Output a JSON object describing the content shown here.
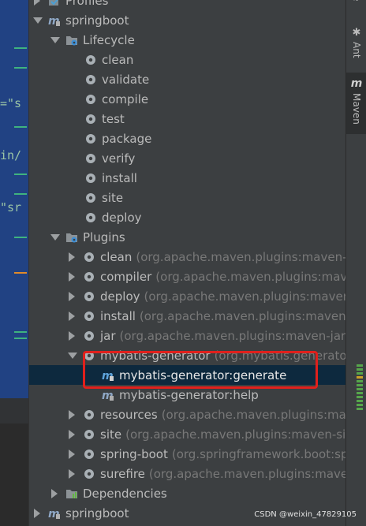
{
  "tree": {
    "top_partial": "Profiles",
    "project": "springboot",
    "lifecycle": {
      "label": "Lifecycle",
      "phases": [
        "clean",
        "validate",
        "compile",
        "test",
        "package",
        "verify",
        "install",
        "site",
        "deploy"
      ]
    },
    "plugins": {
      "label": "Plugins",
      "items": [
        {
          "name": "clean",
          "detail": "(org.apache.maven.plugins:maven-cl"
        },
        {
          "name": "compiler",
          "detail": "(org.apache.maven.plugins:mave"
        },
        {
          "name": "deploy",
          "detail": "(org.apache.maven.plugins:maven-"
        },
        {
          "name": "install",
          "detail": "(org.apache.maven.plugins:maven-in"
        },
        {
          "name": "jar",
          "detail": "(org.apache.maven.plugins:maven-jar-p"
        },
        {
          "name": "mybatis-generator",
          "detail": "(org.mybatis.generator"
        }
      ],
      "goals": [
        "mybatis-generator:generate",
        "mybatis-generator:help"
      ],
      "more": [
        {
          "name": "resources",
          "detail": "(org.apache.maven.plugins:mave"
        },
        {
          "name": "site",
          "detail": "(org.apache.maven.plugins:maven-site"
        },
        {
          "name": "spring-boot",
          "detail": "(org.springframework.boot:sp"
        },
        {
          "name": "surefire",
          "detail": "(org.apache.maven.plugins:maven-"
        }
      ]
    },
    "dependencies": "Dependencies",
    "project2": "springboot"
  },
  "editor_fragments": [
    "=\"s",
    "in/",
    "\"sr"
  ],
  "right_bar": {
    "ant": "Ant",
    "maven": "Maven"
  },
  "watermark": "CSDN @weixin_47829105",
  "colors": {
    "selection": "#0d293e",
    "highlight_box": "#e0201c",
    "panel": "#3c3f41"
  }
}
